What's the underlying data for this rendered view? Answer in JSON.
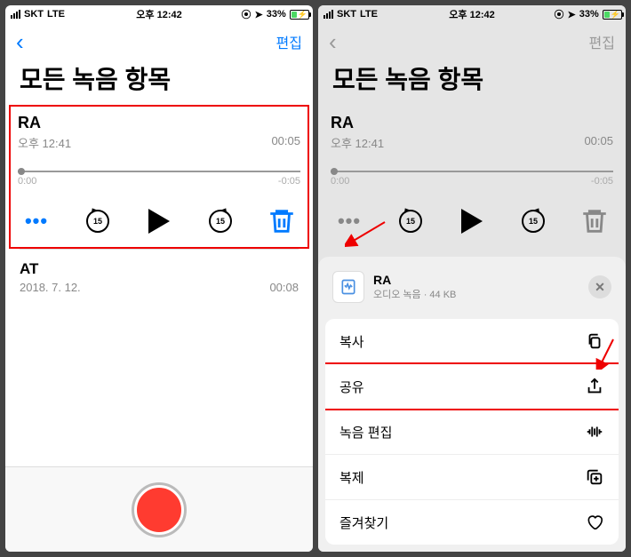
{
  "status": {
    "carrier": "SKT",
    "network": "LTE",
    "time": "오후 12:42",
    "battery_pct": "33%",
    "location_icon": "◉",
    "nav_icon": "➤"
  },
  "nav": {
    "back": "‹",
    "edit": "편집"
  },
  "title": "모든 녹음 항목",
  "expanded": {
    "name": "RA",
    "recorded_at": "오후 12:41",
    "duration": "00:05",
    "scrub_start": "0:00",
    "scrub_end": "-0:05",
    "skip_seconds": "15"
  },
  "items": [
    {
      "name": "AT",
      "date": "2018. 7. 12.",
      "duration": "00:08"
    }
  ],
  "sheet": {
    "file_name": "RA",
    "file_meta": "오디오 녹음 · 44 KB",
    "actions": {
      "copy": "복사",
      "share": "공유",
      "edit_recording": "녹음 편집",
      "duplicate": "복제",
      "favorite": "즐겨찾기"
    }
  }
}
